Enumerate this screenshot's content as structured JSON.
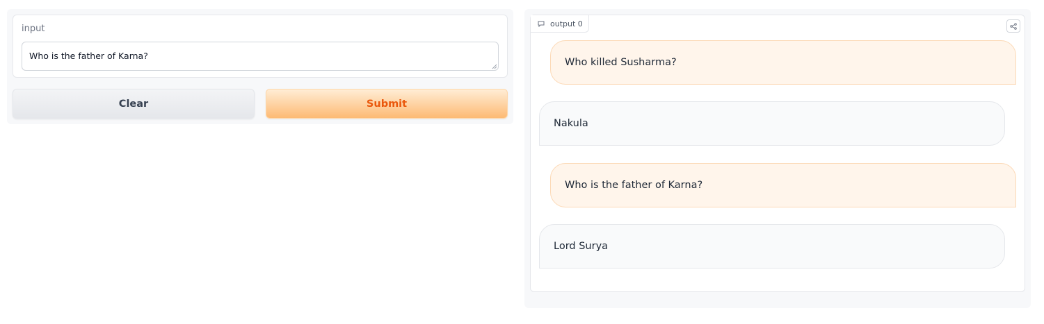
{
  "input_panel": {
    "label": "input",
    "value": "Who is the father of Karna?",
    "clear_label": "Clear",
    "submit_label": "Submit"
  },
  "output_panel": {
    "label": "output 0",
    "messages": [
      {
        "role": "user",
        "text": "Who killed Susharma?"
      },
      {
        "role": "bot",
        "text": "Nakula"
      },
      {
        "role": "user",
        "text": "Who is the father of Karna?"
      },
      {
        "role": "bot",
        "text": "Lord Surya"
      }
    ]
  },
  "colors": {
    "accent": "#ea580c",
    "user_bubble": "#fff5eb",
    "bot_bubble": "#f9fafb"
  }
}
